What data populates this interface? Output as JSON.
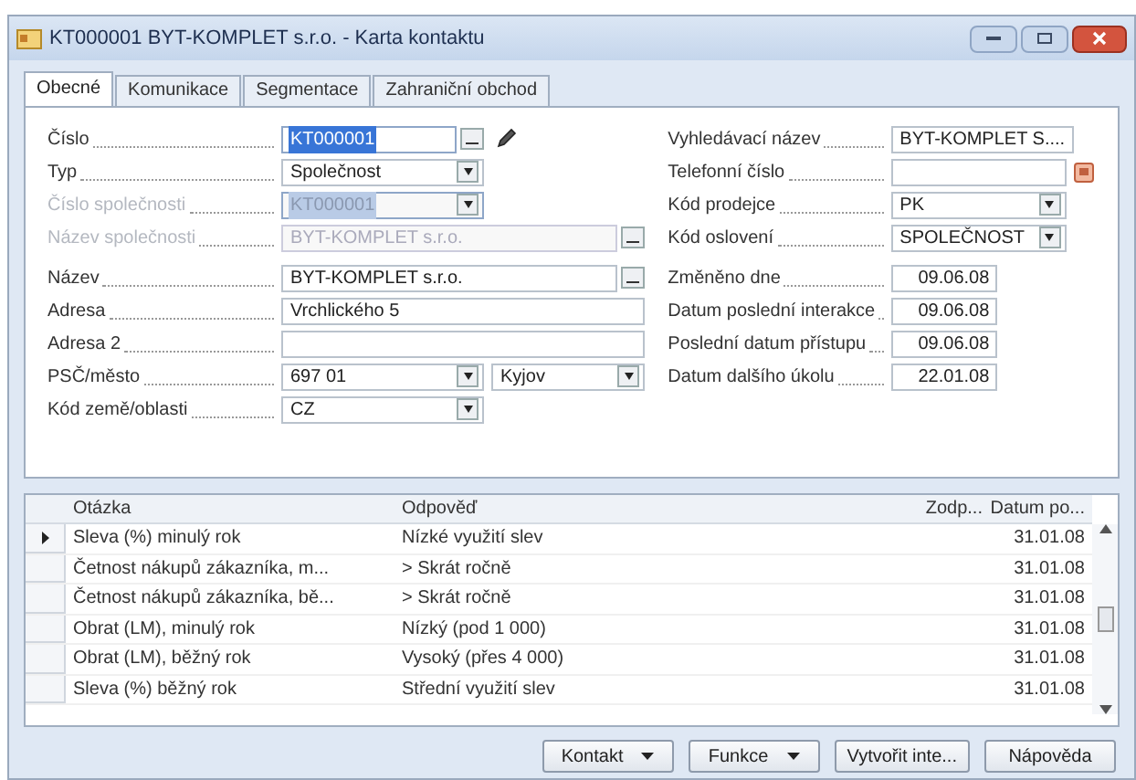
{
  "window": {
    "title": "KT000001 BYT-KOMPLET s.r.o. - Karta kontaktu"
  },
  "tabs": [
    {
      "label": "Obecné",
      "selected": true
    },
    {
      "label": "Komunikace",
      "selected": false
    },
    {
      "label": "Segmentace",
      "selected": false
    },
    {
      "label": "Zahraniční obchod",
      "selected": false
    }
  ],
  "left_fields": [
    {
      "label": "Číslo",
      "kind": "lookup_edit",
      "value": "KT000001",
      "selected": true,
      "disabled": false
    },
    {
      "label": "Typ",
      "kind": "dropdown",
      "value": "Společnost",
      "selected": false,
      "disabled": false
    },
    {
      "label": "Číslo společnosti",
      "kind": "dropdown",
      "value": "KT000001",
      "selected": true,
      "disabled": true
    },
    {
      "label": "Název společnosti",
      "kind": "lookup_wide",
      "value": "BYT-KOMPLET s.r.o.",
      "selected": false,
      "disabled": true
    },
    {
      "label": "Název",
      "kind": "lookup_wide",
      "value": "BYT-KOMPLET s.r.o.",
      "selected": false,
      "disabled": false
    },
    {
      "label": "Adresa",
      "kind": "wide",
      "value": "Vrchlického 5",
      "selected": false,
      "disabled": false
    },
    {
      "label": "Adresa 2",
      "kind": "wide",
      "selected": false,
      "disabled": false
    },
    {
      "label": "PSČ/město",
      "kind": "pair",
      "value": "697 01",
      "value_2": "Kyjov",
      "selected": false,
      "disabled": false
    },
    {
      "label": "Kód země/oblasti",
      "kind": "dropdown",
      "value": "CZ",
      "selected": false,
      "disabled": false
    }
  ],
  "right_fields": [
    {
      "label": "Vyhledávací název",
      "kind": "text",
      "value": "BYT-KOMPLET S...."
    },
    {
      "label": "Telefonní číslo",
      "kind": "phone"
    },
    {
      "label": "Kód prodejce",
      "kind": "dropdown",
      "value": "PK"
    },
    {
      "label": "Kód oslovení",
      "kind": "dropdown",
      "value": "SPOLEČNOST"
    },
    {
      "label": "Změněno dne",
      "kind": "date",
      "value": "09.06.08"
    },
    {
      "label": "Datum poslední interakce",
      "kind": "date",
      "value": "09.06.08"
    },
    {
      "label": "Poslední datum přístupu",
      "kind": "date",
      "value": "09.06.08"
    },
    {
      "label": "Datum dalšího úkolu",
      "kind": "date",
      "value": "22.01.08"
    }
  ],
  "table": {
    "columns": [
      "Otázka",
      "Odpověď",
      "Zodp...",
      "Datum po..."
    ],
    "rows": [
      {
        "cells": [
          "Sleva (%) minulý rok",
          "Nízké využití slev",
          "",
          "31.01.08"
        ],
        "selected": true
      },
      {
        "cells": [
          "Četnost nákupů zákazníka, m...",
          "> Skrát ročně",
          "",
          "31.01.08"
        ],
        "selected": false
      },
      {
        "cells": [
          "Četnost nákupů zákazníka, bě...",
          "> Skrát ročně",
          "",
          "31.01.08"
        ],
        "selected": false
      },
      {
        "cells": [
          "Obrat (LM), minulý rok",
          "Nízký (pod 1 000)",
          "",
          "31.01.08"
        ],
        "selected": false
      },
      {
        "cells": [
          "Obrat (LM), běžný rok",
          "Vysoký (přes 4 000)",
          "",
          "31.01.08"
        ],
        "selected": false
      },
      {
        "cells": [
          "Sleva (%) běžný rok",
          "Střední využití slev",
          "",
          "31.01.08"
        ],
        "selected": false
      }
    ]
  },
  "buttons": [
    {
      "label": "Kontakt",
      "kind": "menu"
    },
    {
      "label": "Funkce",
      "kind": "menu"
    },
    {
      "label": "Vytvořit inte...",
      "kind": "plain"
    },
    {
      "label": "Nápověda",
      "kind": "plain"
    }
  ]
}
